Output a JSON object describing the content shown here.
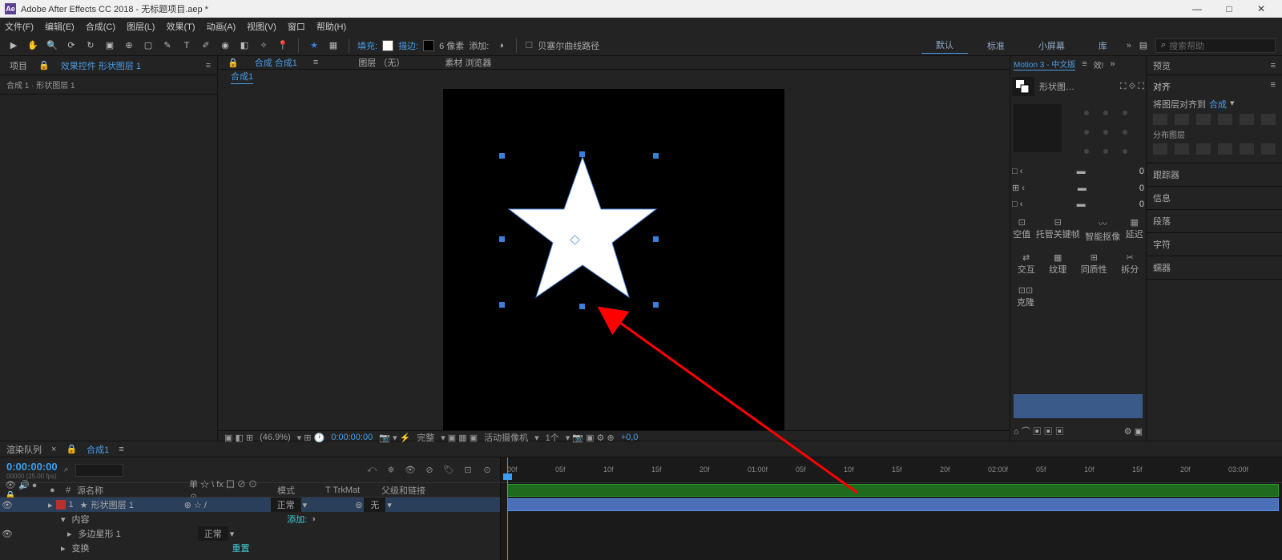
{
  "app": {
    "title": "Adobe After Effects CC 2018 - 无标题项目.aep *"
  },
  "menu": [
    "文件(F)",
    "编辑(E)",
    "合成(C)",
    "图层(L)",
    "效果(T)",
    "动画(A)",
    "视图(V)",
    "窗口",
    "帮助(H)"
  ],
  "toolbar": {
    "fill": "填充:",
    "stroke": "描边:",
    "px": "6 像素",
    "add": "添加:",
    "bezier": "贝塞尔曲线路径",
    "workspaces": [
      "默认",
      "标准",
      "小屏幕",
      "库"
    ],
    "search_ph": "搜索帮助"
  },
  "project": {
    "tabs": [
      "项目",
      "效果控件 形状图层 1"
    ],
    "path": "合成 1 · 形状图层 1"
  },
  "comp": {
    "tabs": {
      "lock": "🔒",
      "comp": "合成 合成1",
      "layer": "图层 （无）",
      "footage": "素材 浏览器"
    },
    "sub": "合成1",
    "footer": {
      "zoom": "(46.9%)",
      "time": "0:00:00:00",
      "full": "完整",
      "cam": "活动摄像机",
      "view": "1个",
      "px": "+0,0"
    }
  },
  "motion": {
    "tab1": "Motion 3 - 中文版",
    "tab2": "效!",
    "shape_label": "形状图…",
    "zero": "0",
    "row1": [
      "空值",
      "托管关键帧",
      "智能抠像",
      "延迟"
    ],
    "row2": [
      "交互",
      "纹理",
      "同质性",
      "拆分"
    ],
    "clone": "克隆"
  },
  "right": {
    "preview": "预览",
    "align": "对齐",
    "align_to_l": "将图层对齐到",
    "align_to_v": "合成",
    "dist": "分布图层",
    "tracker": "跟踪器",
    "info": "信息",
    "paragraph": "段落",
    "char": "字符",
    "wiggler": "蠕器"
  },
  "timeline": {
    "render_tab": "渲染队列",
    "comp_tab": "合成1",
    "timecode": "0:00:00:00",
    "fps": "00000 (25.00 fps)",
    "cols": {
      "src": "源名称",
      "switches": "单 ☆ \\ fx 囗 ⊘ ⊙ ☉",
      "mode": "模式",
      "trk": "T  TrkMat",
      "parent": "父级和链接"
    },
    "layer1": {
      "num": "1",
      "name": "形状图层 1",
      "mode": "正常",
      "parent": "无"
    },
    "sub_content": "内容",
    "sub_add": "添加:",
    "sub_poly": "多边星形 1",
    "sub_mode": "正常",
    "sub_xform": "变换",
    "sub_reset": "重置",
    "ticks": [
      "00f",
      "05f",
      "10f",
      "15f",
      "20f",
      "01:00f",
      "05f",
      "10f",
      "15f",
      "20f",
      "02:00f",
      "05f",
      "10f",
      "15f",
      "20f",
      "03:00f"
    ]
  }
}
